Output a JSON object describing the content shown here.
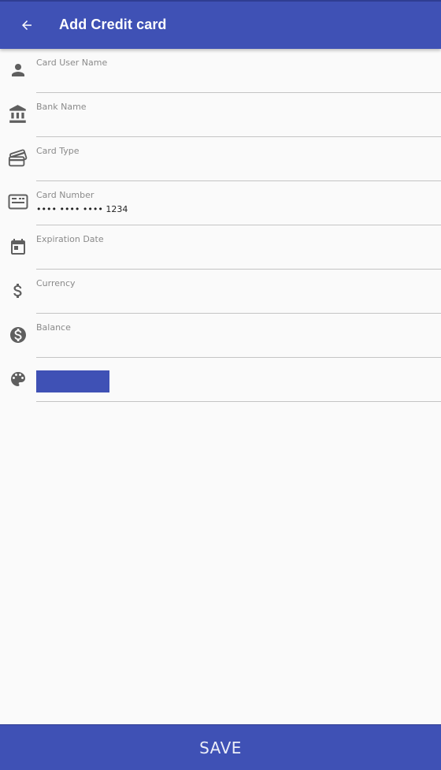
{
  "app_bar": {
    "title": "Add Credit card",
    "back_icon": "arrow-back-icon"
  },
  "colors": {
    "primary": "#3f51b5",
    "icon_gray": "#5f5f5f",
    "label_gray": "#8a8a8a",
    "divider": "#c4c4c4"
  },
  "form": {
    "fields": [
      {
        "id": "card-user-name",
        "icon": "person-icon",
        "label": "Card User Name",
        "value": ""
      },
      {
        "id": "bank-name",
        "icon": "bank-icon",
        "label": "Bank Name",
        "value": ""
      },
      {
        "id": "card-type",
        "icon": "cards-icon",
        "label": "Card Type",
        "value": ""
      },
      {
        "id": "card-number",
        "icon": "credit-card-icon",
        "label": "Card Number",
        "value": "••••   ••••   ••••   1234"
      },
      {
        "id": "expiration-date",
        "icon": "calendar-icon",
        "label": "Expiration Date",
        "value": ""
      },
      {
        "id": "currency",
        "icon": "dollar-sign-icon",
        "label": "Currency",
        "value": ""
      },
      {
        "id": "balance",
        "icon": "dollar-circle-icon",
        "label": "Balance",
        "value": ""
      }
    ],
    "color_field": {
      "icon": "palette-icon",
      "selected_color": "#3f51b5"
    }
  },
  "footer": {
    "save_label": "SAVE"
  }
}
